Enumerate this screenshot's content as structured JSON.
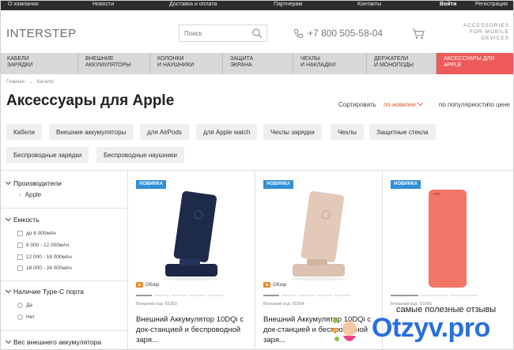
{
  "topbar": {
    "links": [
      "О компании",
      "Новости",
      "Доставка и оплата",
      "Партнерам",
      "Контакты"
    ],
    "login": "Войти",
    "register": "Регистрация"
  },
  "header": {
    "logo_text": "INTERSTEP",
    "search_placeholder": "Поиск",
    "phone": "+7 800 505-58-04",
    "tagline_lines": [
      "ACCESSORIES",
      "FOR MOBILE",
      "DEVICES"
    ]
  },
  "categories": [
    {
      "line1": "Кабели",
      "line2": "зарядки"
    },
    {
      "line1": "Внешние",
      "line2": "аккумуляторы"
    },
    {
      "line1": "Колонки",
      "line2": "и наушники"
    },
    {
      "line1": "Защита",
      "line2": "экрана"
    },
    {
      "line1": "Чехлы",
      "line2": "и накладки"
    },
    {
      "line1": "Держатели",
      "line2": "и монoподы"
    },
    {
      "line1": "Аксессуары для",
      "line2": "Apple"
    }
  ],
  "breadcrumb": [
    "Главная",
    "→",
    "Каталог"
  ],
  "page_title": "Аксессуары для Apple",
  "sort": {
    "label": "Сортировать",
    "options": [
      "по новизне",
      "по популярности",
      "по цене"
    ],
    "active": "по новизне"
  },
  "chips": [
    "Кабели",
    "Внешние аккумуляторы",
    "для AirPods",
    "для Apple watch",
    "Чехлы зарядки",
    "Чехлы",
    "Защитные стекла",
    "Беспроводные зарядки",
    "Беспроводные наушники"
  ],
  "sidebar": {
    "manufacturers": {
      "title": "Производители",
      "items": [
        "Apple"
      ]
    },
    "capacity": {
      "title": "Емкость",
      "options": [
        "до 6 000мАч",
        "6 000 - 12 000мАч",
        "12 000 - 18 000мАч",
        "18 000 - 24 000мАч"
      ]
    },
    "typec": {
      "title": "Наличие Type-C порта",
      "options": [
        "Да",
        "Нет"
      ]
    },
    "weight": {
      "title": "Вес внешнего аккумулятора"
    }
  },
  "products": [
    {
      "badge": "Новинка",
      "review": "Обзор",
      "code": "Внешний код: 65363",
      "name": "Внешний Аккумулятор 10DQi с док-станцией и беспроводной заря...",
      "color": "#1e2a4a"
    },
    {
      "badge": "Новинка",
      "review": "Обзор",
      "code": "Внешний код: 65364",
      "name": "Внешний Аккумулятор 10DQi с док-станцией и беспроводной заря...",
      "color": "#e3c9b8"
    },
    {
      "badge": "Новинка",
      "review": "",
      "code": "Внешний код: 63056",
      "name": "",
      "color": "#f27668"
    }
  ],
  "watermark": {
    "caption": "самые полезные отзывы",
    "logo": "Otzyv.pro"
  },
  "colors": {
    "topbar": "#2c2c2c",
    "accent_red": "#ee5a5a",
    "badge_blue": "#2f8fd8",
    "sort_active": "#e25b2a"
  }
}
